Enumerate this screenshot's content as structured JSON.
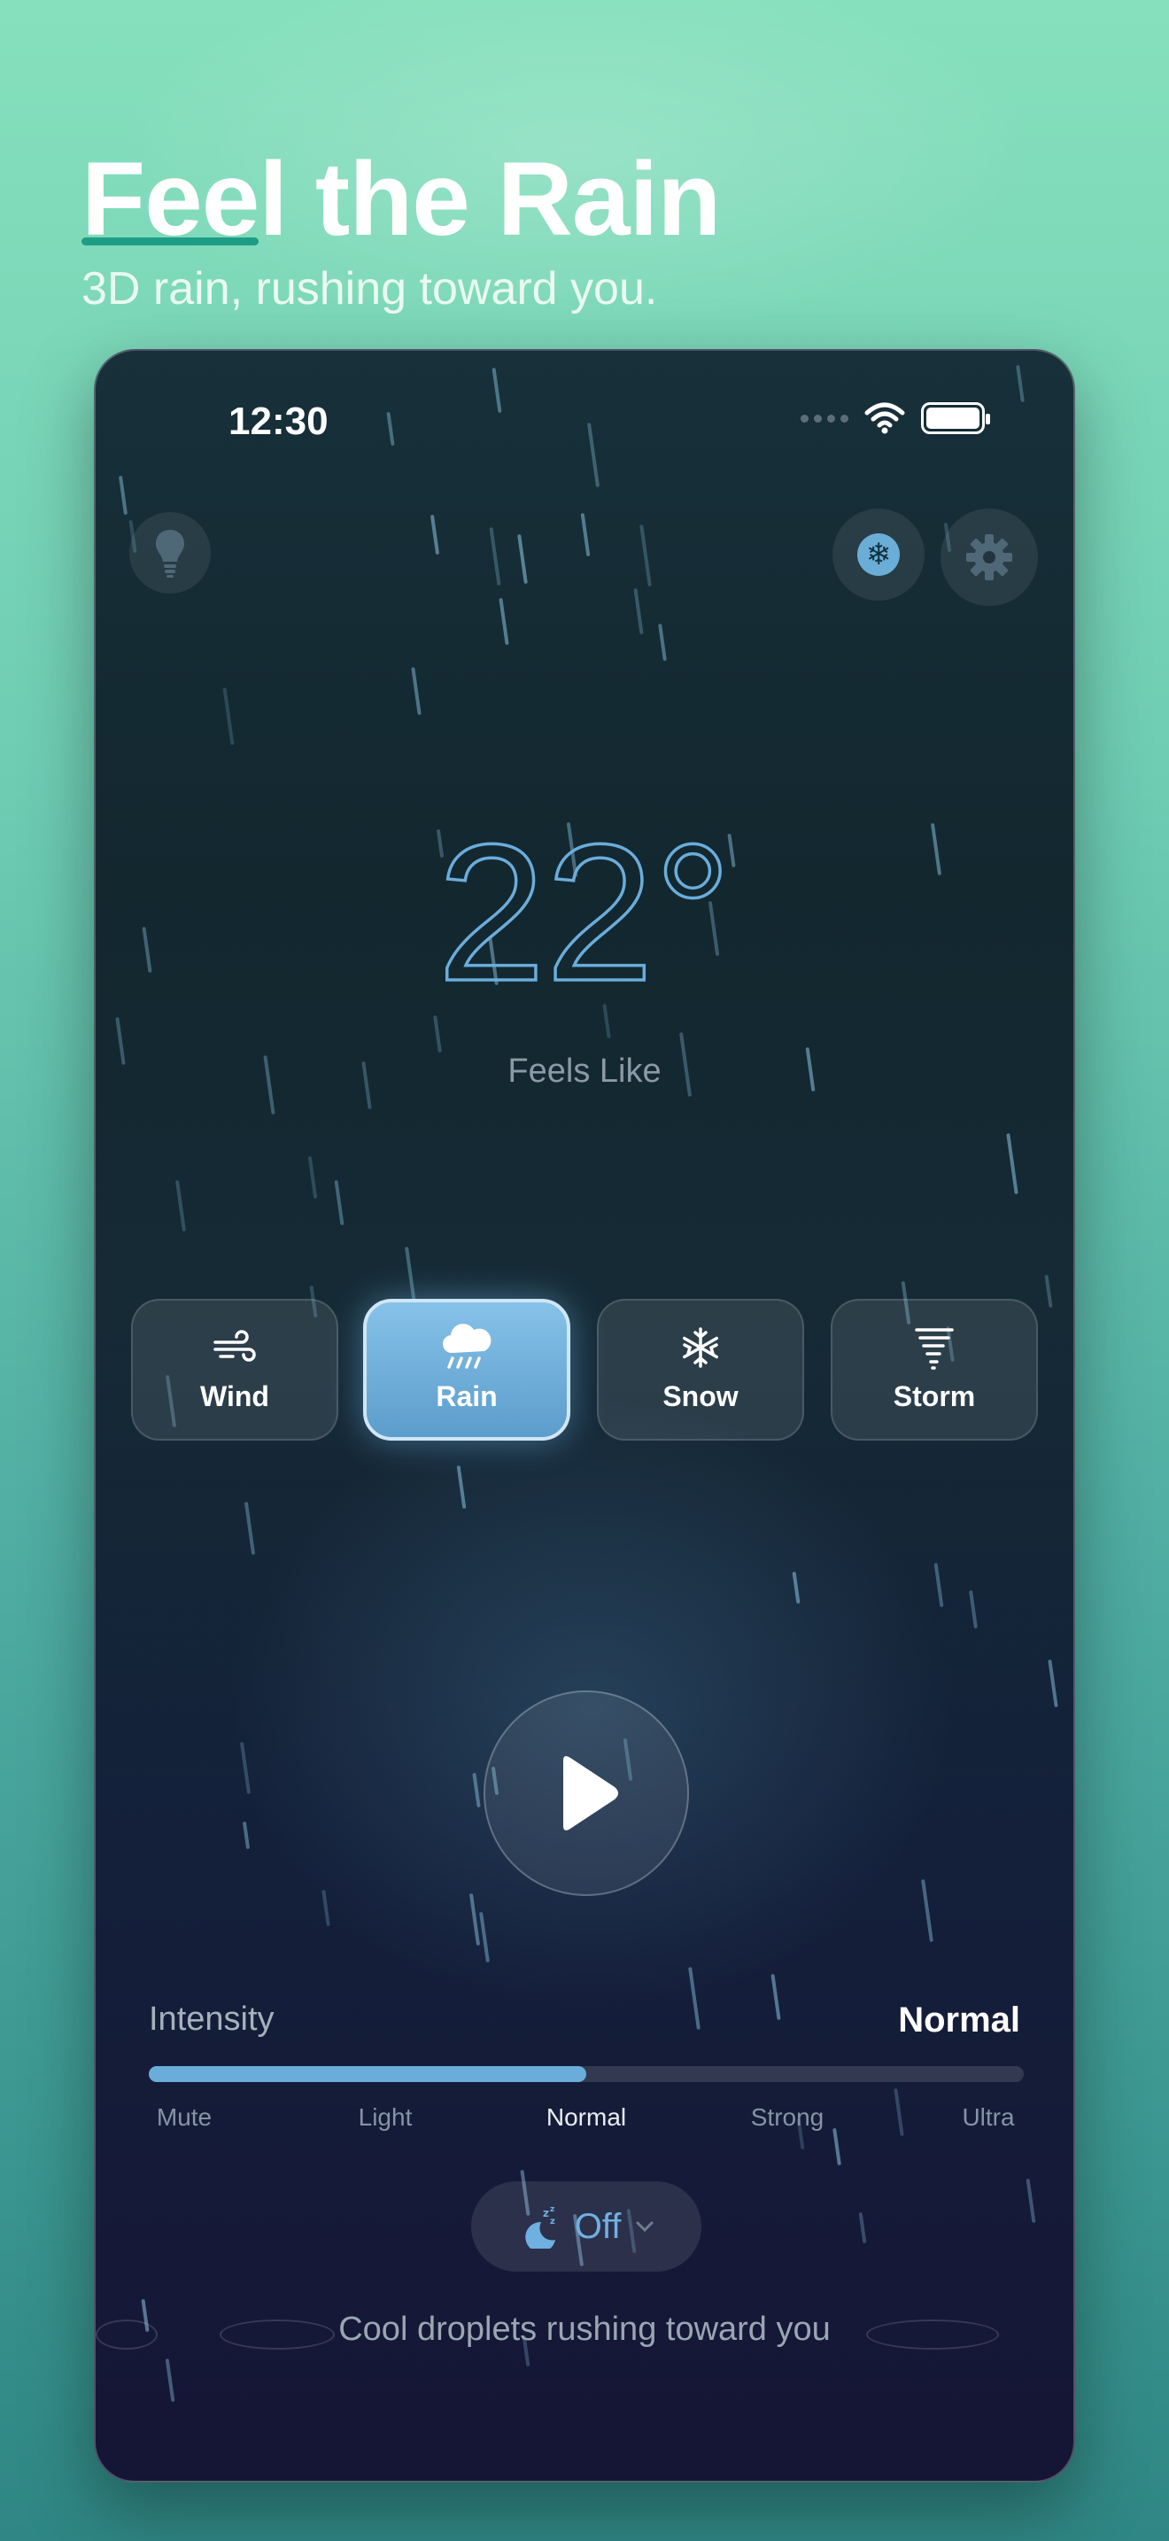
{
  "header": {
    "title": "Feel the Rain",
    "subtitle": "3D rain, rushing toward you."
  },
  "status_bar": {
    "time": "12:30",
    "icons": [
      "signal-dots-icon",
      "wifi-icon",
      "battery-icon"
    ]
  },
  "toolbar": {
    "left_icon": "lightbulb-icon",
    "right_icons": [
      "snowflake-icon",
      "gear-icon"
    ]
  },
  "temperature": {
    "value": "22°",
    "caption": "Feels Like"
  },
  "modes": [
    {
      "label": "Wind",
      "icon": "wind-icon",
      "active": false
    },
    {
      "label": "Rain",
      "icon": "rain-cloud-icon",
      "active": true
    },
    {
      "label": "Snow",
      "icon": "snowflake-icon",
      "active": false
    },
    {
      "label": "Storm",
      "icon": "tornado-icon",
      "active": false
    }
  ],
  "player": {
    "icon": "play-icon"
  },
  "intensity": {
    "label": "Intensity",
    "value": "Normal",
    "level_fraction": 0.5,
    "steps": [
      "Mute",
      "Light",
      "Normal",
      "Strong",
      "Ultra"
    ],
    "selected_step": 2
  },
  "sleep_timer": {
    "icon": "moon-sleep-icon",
    "label": "Off",
    "chevron": "chevron-down-icon"
  },
  "footer_caption": "Cool droplets rushing toward you",
  "colors": {
    "accent": "#6aaddb",
    "active_mode": "#78b6e2",
    "underline": "#1f9d84",
    "background_top": "#86e0bd",
    "background_bottom": "#2f8684"
  }
}
